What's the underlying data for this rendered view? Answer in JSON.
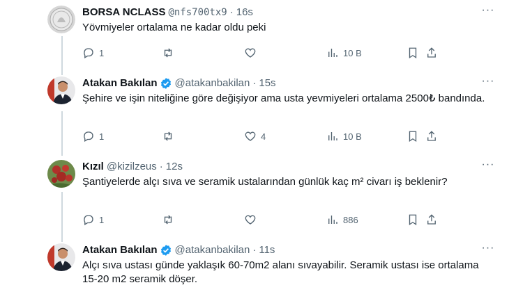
{
  "tweets": [
    {
      "name": "BORSA NCLASS",
      "handle": "@nfs700tx9",
      "separator": "·",
      "time": "16s",
      "verified": false,
      "text": "Yövmiyeler ortalama ne kadar oldu  peki",
      "reply_count": "1",
      "retweet_count": "",
      "like_count": "",
      "views": "10 B"
    },
    {
      "name": "Atakan Bakılan",
      "handle": "@atakanbakilan",
      "separator": "·",
      "time": "15s",
      "verified": true,
      "text": "Şehire ve işin niteliğine göre değişiyor ama usta yevmiyeleri ortalama 2500₺ bandında.",
      "reply_count": "1",
      "retweet_count": "",
      "like_count": "4",
      "views": "10 B"
    },
    {
      "name": "Kızıl",
      "handle": "@kizilzeus",
      "separator": "·",
      "time": "12s",
      "verified": false,
      "text": "Şantiyelerde alçı sıva ve seramik ustalarından günlük kaç m² civarı iş beklenir?",
      "reply_count": "1",
      "retweet_count": "",
      "like_count": "",
      "views": "886"
    },
    {
      "name": "Atakan Bakılan",
      "handle": "@atakanbakilan",
      "separator": "·",
      "time": "11s",
      "verified": true,
      "text": "Alçı sıva ustası günde yaklaşık 60-70m2 alanı sıvayabilir. Seramik ustası ise ortalama 15-20 m2 seramik döşer."
    }
  ],
  "icons": {
    "reply": "reply-icon",
    "retweet": "retweet-icon",
    "like": "heart-icon",
    "views": "views-bar-chart-icon",
    "bookmark": "bookmark-icon",
    "share": "share-icon",
    "more": "more-dots-icon",
    "verified": "verified-badge-icon"
  },
  "colors": {
    "text": "#0f1419",
    "secondary": "#536471",
    "verified_blue": "#1d9bf0",
    "thread_line": "#cfd9de"
  }
}
